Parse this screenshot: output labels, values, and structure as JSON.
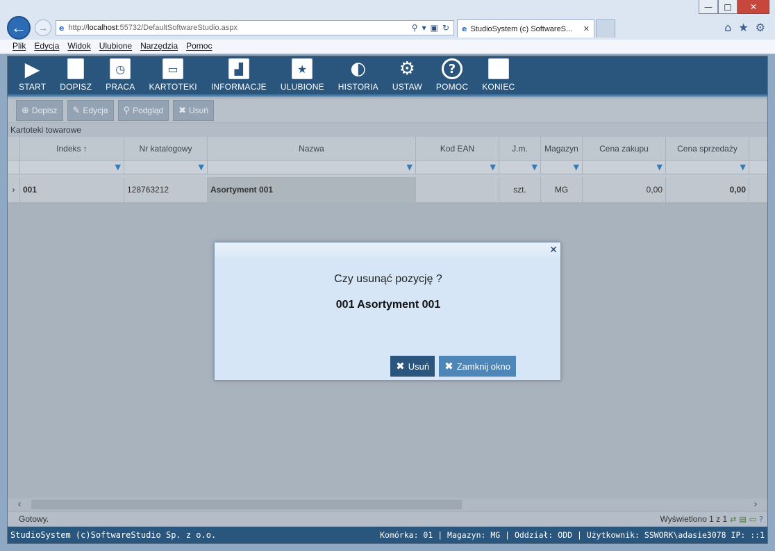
{
  "browser": {
    "window_controls": {
      "minimize": "—",
      "maximize": "□",
      "close": "✕"
    },
    "back_glyph": "←",
    "forward_glyph": "→",
    "url_prefix": "http://",
    "url_host": "localhost",
    "url_tail": ":55732/DefaultSoftwareStudio.aspx",
    "tab_title": "StudioSystem (c) SoftwareS...",
    "tab_close": "✕",
    "addr_icons": [
      "⚲",
      "▾",
      "▣",
      "↻"
    ],
    "right_icons": [
      "⌂",
      "★",
      "⚙"
    ],
    "menu": [
      "Plik",
      "Edycja",
      "Widok",
      "Ulubione",
      "Narzędzia",
      "Pomoc"
    ]
  },
  "toolbar": {
    "items": [
      {
        "label": "START",
        "icon": "play-icon",
        "glyph": "▶"
      },
      {
        "label": "DOPISZ",
        "icon": "document-icon",
        "glyph": ""
      },
      {
        "label": "PRACA",
        "icon": "clock-window-icon",
        "glyph": "◷"
      },
      {
        "label": "KARTOTEKI",
        "icon": "window-icon",
        "glyph": "▭"
      },
      {
        "label": "INFORMACJE",
        "icon": "bar-chart-icon",
        "glyph": "▟"
      },
      {
        "label": "ULUBIONE",
        "icon": "star-window-icon",
        "glyph": "★"
      },
      {
        "label": "HISTORIA",
        "icon": "history-icon",
        "glyph": "◐"
      },
      {
        "label": "USTAW",
        "icon": "gears-icon",
        "glyph": "⚙"
      },
      {
        "label": "POMOC",
        "icon": "help-icon",
        "glyph": "?"
      },
      {
        "label": "KONIEC",
        "icon": "blank-window-icon",
        "glyph": ""
      }
    ]
  },
  "actions": {
    "dopisz": {
      "label": "Dopisz",
      "glyph": "⊕"
    },
    "edycja": {
      "label": "Edycja",
      "glyph": "✎"
    },
    "podglad": {
      "label": "Podgląd",
      "glyph": "⚲"
    },
    "usun": {
      "label": "Usuń",
      "glyph": "✖"
    }
  },
  "section_title": "Kartoteki towarowe",
  "grid": {
    "columns": [
      "Indeks ↑",
      "Nr katalogowy",
      "Nazwa",
      "Kod EAN",
      "J.m.",
      "Magazyn",
      "Cena zakupu",
      "Cena sprzedaży"
    ],
    "filter_glyph": "▼",
    "row_indicator": "›",
    "rows": [
      {
        "indeks": "001",
        "nr_katalogowy": "128763212",
        "nazwa": "Asortyment 001",
        "kod_ean": "",
        "jm": "szt.",
        "magazyn": "MG",
        "cena_zakupu": "0,00",
        "cena_sprzedazy": "0,00"
      }
    ]
  },
  "scroll": {
    "left": "‹",
    "right": "›"
  },
  "status": {
    "text": "Gotowy.",
    "count": "Wyświetlono 1 z 1",
    "icons": [
      "⇄",
      "▤",
      "▭",
      "?"
    ]
  },
  "footer": {
    "left": "StudioSystem (c)SoftwareStudio Sp. z o.o.",
    "right": "Komórka: 01 | Magazyn: MG | Oddział: ODD | Użytkownik: SSWORK\\adasie3078 IP: ::1"
  },
  "dialog": {
    "close_glyph": "✕",
    "question": "Czy usunąć pozycję ?",
    "item": "001 Asortyment 001",
    "confirm": {
      "label": "Usuń",
      "glyph": "✖"
    },
    "cancel": {
      "label": "Zamknij okno",
      "glyph": "✖"
    }
  },
  "colors": {
    "toolbar_bg": "#2a567d",
    "dialog_bg": "#d6e6f7",
    "primary_button": "#2a567d",
    "secondary_button": "#4f86b8"
  }
}
